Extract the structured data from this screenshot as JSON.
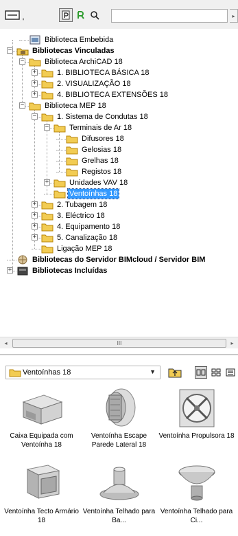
{
  "search": {
    "value": "",
    "placeholder": ""
  },
  "colors": {
    "selection": "#3399ff",
    "folder": "#f2cc53",
    "green_icon": "#2e9c2e"
  },
  "icons": {
    "view_toggle": "view-mode-icon",
    "folder_mode": "library-folder-icon",
    "green_mode": "green-library-icon",
    "find": "search-icon",
    "up": "folder-up-icon",
    "large_icons": "large-icons-view-icon",
    "small_icons": "small-icons-view-icon",
    "list": "list-view-icon"
  },
  "tree": [
    {
      "label": "Biblioteca Embebida",
      "icon": "embedded-library-icon",
      "level": 1,
      "bold": false,
      "expander": "none"
    },
    {
      "label": "Bibliotecas Vinculadas",
      "icon": "linked-libraries-icon",
      "level": 0,
      "bold": true,
      "expander": "minus"
    },
    {
      "label": "Biblioteca ArchiCAD 18",
      "icon": "folder-icon",
      "level": 1,
      "bold": false,
      "expander": "minus"
    },
    {
      "label": "1. BIBLIOTECA BÁSICA 18",
      "icon": "folder-icon",
      "level": 2,
      "bold": false,
      "expander": "plus"
    },
    {
      "label": "2. VISUALIZAÇÃO 18",
      "icon": "folder-icon",
      "level": 2,
      "bold": false,
      "expander": "plus"
    },
    {
      "label": "4. BIBLIOTECA EXTENSÕES 18",
      "icon": "folder-icon",
      "level": 2,
      "bold": false,
      "expander": "plus"
    },
    {
      "label": "Biblioteca MEP 18",
      "icon": "folder-icon",
      "level": 1,
      "bold": false,
      "expander": "minus"
    },
    {
      "label": "1. Sistema de Condutas 18",
      "icon": "folder-icon",
      "level": 2,
      "bold": false,
      "expander": "minus"
    },
    {
      "label": "Terminais de Ar 18",
      "icon": "folder-icon",
      "level": 3,
      "bold": false,
      "expander": "minus"
    },
    {
      "label": "Difusores 18",
      "icon": "folder-icon",
      "level": 4,
      "bold": false,
      "expander": "none"
    },
    {
      "label": "Gelosias 18",
      "icon": "folder-icon",
      "level": 4,
      "bold": false,
      "expander": "none"
    },
    {
      "label": "Grelhas 18",
      "icon": "folder-icon",
      "level": 4,
      "bold": false,
      "expander": "none"
    },
    {
      "label": "Registos 18",
      "icon": "folder-icon",
      "level": 4,
      "bold": false,
      "expander": "none"
    },
    {
      "label": "Unidades VAV 18",
      "icon": "folder-icon",
      "level": 3,
      "bold": false,
      "expander": "plus"
    },
    {
      "label": "Ventoínhas 18",
      "icon": "folder-icon",
      "level": 3,
      "bold": false,
      "expander": "none",
      "selected": true
    },
    {
      "label": "2. Tubagem 18",
      "icon": "folder-icon",
      "level": 2,
      "bold": false,
      "expander": "plus"
    },
    {
      "label": "3. Eléctrico 18",
      "icon": "folder-icon",
      "level": 2,
      "bold": false,
      "expander": "plus"
    },
    {
      "label": "4. Equipamento 18",
      "icon": "folder-icon",
      "level": 2,
      "bold": false,
      "expander": "plus"
    },
    {
      "label": "5. Canalização 18",
      "icon": "folder-icon",
      "level": 2,
      "bold": false,
      "expander": "plus"
    },
    {
      "label": "Ligação MEP 18",
      "icon": "folder-icon",
      "level": 2,
      "bold": false,
      "expander": "none"
    },
    {
      "label": "Bibliotecas do Servidor BIMcloud / Servidor BIM",
      "icon": "server-libraries-icon",
      "level": 0,
      "bold": true,
      "expander": "none"
    },
    {
      "label": "Bibliotecas Incluídas",
      "icon": "included-libraries-icon",
      "level": 0,
      "bold": true,
      "expander": "plus"
    }
  ],
  "hscroll": {
    "thumb_label": "III"
  },
  "folder_select": {
    "value": "Ventoínhas 18"
  },
  "objects": [
    {
      "label": "Caixa Equipada com Ventoínha 18",
      "icon": "boxed-fan-icon"
    },
    {
      "label": "Ventoínha Escape Parede Lateral 18",
      "icon": "wall-exhaust-fan-icon"
    },
    {
      "label": "Ventoínha Propulsora 18",
      "icon": "propeller-fan-icon"
    },
    {
      "label": "Ventoínha Tecto Armário 18",
      "icon": "ceiling-cabinet-fan-icon"
    },
    {
      "label": "Ventoínha Telhado para Ba...",
      "icon": "roof-fan-low-icon"
    },
    {
      "label": "Ventoínha Telhado para Ci...",
      "icon": "roof-fan-up-icon"
    }
  ]
}
